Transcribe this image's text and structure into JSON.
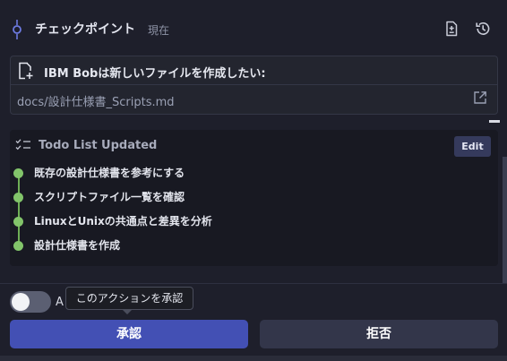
{
  "checkpoint": {
    "title": "チェックポイント",
    "current_label": "現在"
  },
  "file_card": {
    "title": "IBM Bobは新しいファイルを作成したい:",
    "path": "docs/設計仕様書_Scripts.md"
  },
  "todo": {
    "title": "Todo List Updated",
    "edit_label": "Edit",
    "items": [
      "既存の設計仕様書を参考にする",
      "スクリプトファイル一覧を確認",
      "LinuxとUnixの共通点と差異を分析",
      "設計仕様書を作成"
    ]
  },
  "actions": {
    "auto_label": "A",
    "tooltip": "このアクションを承認",
    "approve_label": "承認",
    "reject_label": "拒否"
  },
  "colors": {
    "background": "#1e1f2b",
    "approve": "#4350b4",
    "reject": "#33364a",
    "todo_dot": "#82c46a"
  }
}
